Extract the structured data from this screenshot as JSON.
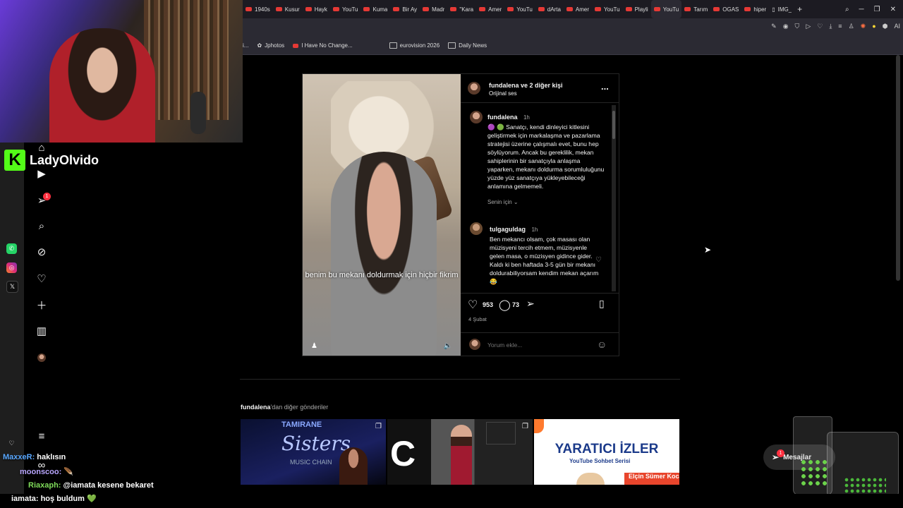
{
  "browser": {
    "tabs": [
      {
        "label": "1940s"
      },
      {
        "label": "Kusur"
      },
      {
        "label": "Hayk"
      },
      {
        "label": "YouTu"
      },
      {
        "label": "Kuma"
      },
      {
        "label": "Bir Ay"
      },
      {
        "label": "Madr"
      },
      {
        "label": "\"Kara"
      },
      {
        "label": "Amer"
      },
      {
        "label": "YouTu"
      },
      {
        "label": "dArta"
      },
      {
        "label": "Amer"
      },
      {
        "label": "YouTu"
      },
      {
        "label": "Playli"
      },
      {
        "label": "YouTu"
      },
      {
        "label": "Tarım"
      },
      {
        "label": "OGAS"
      },
      {
        "label": "hiper"
      },
      {
        "label": "IMG_"
      }
    ],
    "new_tab": "+",
    "toolbar_ai": "AI",
    "bookmarks": [
      {
        "label": "i..."
      },
      {
        "label": "Jphotos"
      },
      {
        "label": "I Have No Change..."
      },
      {
        "label": "eurovision 2026"
      },
      {
        "label": "Daily News"
      }
    ]
  },
  "stream": {
    "streamer_name": "LadyOlvido",
    "kick_letter": "K"
  },
  "instagram": {
    "notification_count": "1",
    "post": {
      "header_user": "fundalena",
      "header_rest": " ve 2 diğer kişi",
      "audio": "Orijinal ses",
      "more": "...",
      "subtitle": "benim bu mekanı doldurmak için hiçbir fikrim",
      "caption_user": "fundalena",
      "caption_time": "1h",
      "caption_text": "🟣 🟢 Sanatçı, kendi dinleyici kitlesini geliştirmek için markalaşma ve pazarlama stratejisi üzerine çalışmalı evet, bunu hep söylüyorum. Ancak bu gereklilik, mekan sahiplerinin bir sanatçıyla anlaşma yaparken, mekanı doldurma sorumluluğunu yüzde yüz sanatçıya yükleyebileceği anlamına gelmemeli.",
      "see_translation": "Senin için ⌄",
      "comment_user": "tulgaguldag",
      "comment_time": "1h",
      "comment_text": "Ben mekancı olsam, çok masası olan müzisyeni tercih etmem, müzisyenle gelen masa, o müzisyen gidince gider. Kaldı ki ben haftada 3-5 gün bir mekanı doldurabiliyorsam kendim mekan açarım 😂",
      "likes": "953",
      "comments": "73",
      "date": "4 Şubat",
      "add_comment_placeholder": "Yorum ekle..."
    },
    "more_posts_user": "fundalena",
    "more_posts_rest": "'dan diğer gönderiler",
    "thumb1_text_top": "TAMIRANE",
    "thumb1_text": "Sisters",
    "thumb1_sub": "MUSIC CHAIN",
    "thumb2_text": "C",
    "thumb3_title": "YARATICI İZLER",
    "thumb3_sub": "YouTube Sohbet Serisi",
    "thumb3_name": "Elçin Sümer Kocak",
    "messages_label": "Mesajlar",
    "messages_badge": "1"
  },
  "chat": [
    {
      "user": "MaxxeR:",
      "text": " haklısın"
    },
    {
      "user": "moonscoo:",
      "text": " 🪶"
    },
    {
      "user": "Riaxaph:",
      "text": " @iamata kesene bekaret"
    },
    {
      "user": "iamata:",
      "text": " hoş buldum 💚"
    }
  ],
  "colors": {
    "kick_green": "#53fc18",
    "instagram_bg": "#000000",
    "youtube_red": "#e53935",
    "badge_red": "#ff3040"
  }
}
